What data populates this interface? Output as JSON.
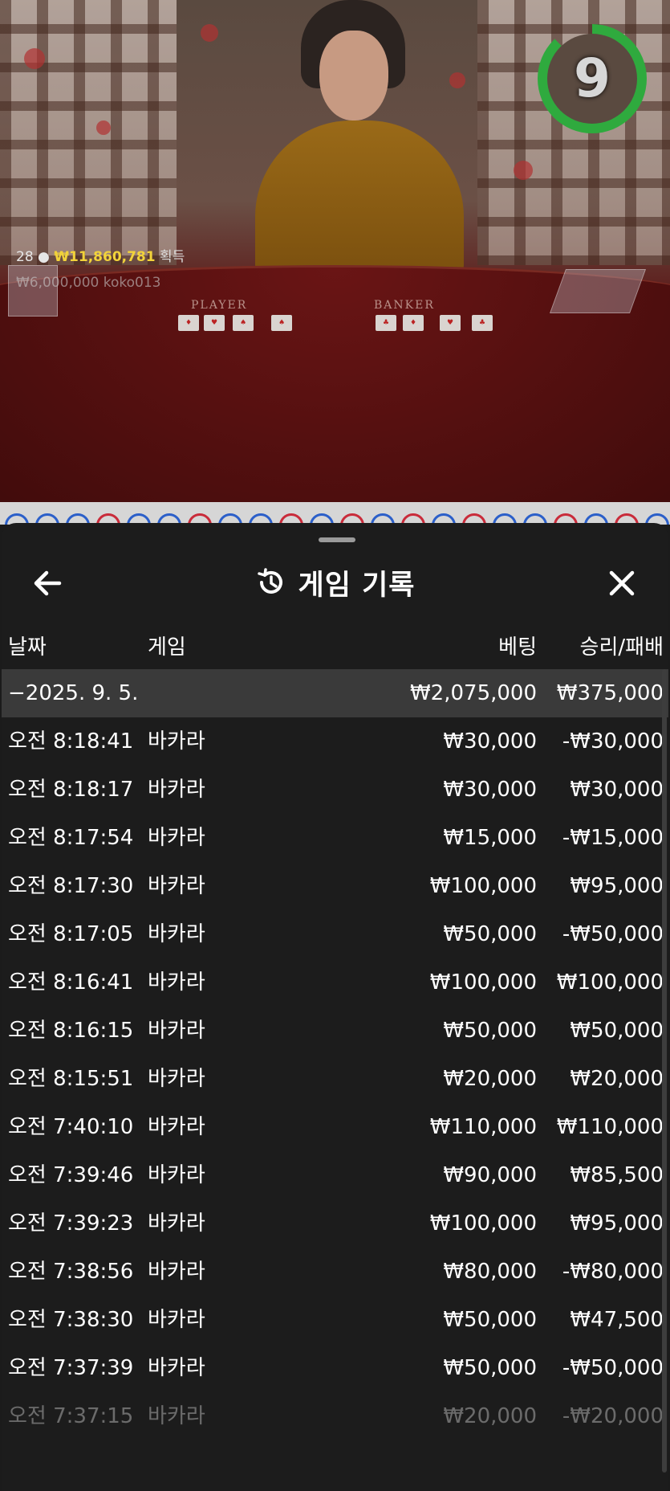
{
  "video": {
    "table_labels": {
      "player": "PLAYER",
      "banker": "BANKER"
    },
    "viewers": "28",
    "win_amount": "₩11,860,781",
    "win_suffix": "획득",
    "last_bet": "₩6,000,000",
    "last_user": "koko013",
    "countdown": "9",
    "countdown_progress": 0.88,
    "colors": {
      "timer": "#2faa3e",
      "win_amount": "#f2d33a"
    }
  },
  "sheet": {
    "title": "게임 기록",
    "back_icon": "arrow-left-icon",
    "title_icon": "history-icon",
    "close_icon": "close-icon",
    "columns": {
      "date": "날짜",
      "game": "게임",
      "bet": "베팅",
      "result": "승리/패배"
    },
    "day": {
      "date": "−2025. 9. 5.",
      "bet": "₩2,075,000",
      "result": "₩375,000"
    },
    "rows": [
      {
        "time": "오전 8:18:41",
        "game": "바카라",
        "bet": "₩30,000",
        "result": "-₩30,000"
      },
      {
        "time": "오전 8:18:17",
        "game": "바카라",
        "bet": "₩30,000",
        "result": "₩30,000"
      },
      {
        "time": "오전 8:17:54",
        "game": "바카라",
        "bet": "₩15,000",
        "result": "-₩15,000"
      },
      {
        "time": "오전 8:17:30",
        "game": "바카라",
        "bet": "₩100,000",
        "result": "₩95,000"
      },
      {
        "time": "오전 8:17:05",
        "game": "바카라",
        "bet": "₩50,000",
        "result": "-₩50,000"
      },
      {
        "time": "오전 8:16:41",
        "game": "바카라",
        "bet": "₩100,000",
        "result": "₩100,000"
      },
      {
        "time": "오전 8:16:15",
        "game": "바카라",
        "bet": "₩50,000",
        "result": "₩50,000"
      },
      {
        "time": "오전 8:15:51",
        "game": "바카라",
        "bet": "₩20,000",
        "result": "₩20,000"
      },
      {
        "time": "오전 7:40:10",
        "game": "바카라",
        "bet": "₩110,000",
        "result": "₩110,000"
      },
      {
        "time": "오전 7:39:46",
        "game": "바카라",
        "bet": "₩90,000",
        "result": "₩85,500"
      },
      {
        "time": "오전 7:39:23",
        "game": "바카라",
        "bet": "₩100,000",
        "result": "₩95,000"
      },
      {
        "time": "오전 7:38:56",
        "game": "바카라",
        "bet": "₩80,000",
        "result": "-₩80,000"
      },
      {
        "time": "오전 7:38:30",
        "game": "바카라",
        "bet": "₩50,000",
        "result": "₩47,500"
      },
      {
        "time": "오전 7:37:39",
        "game": "바카라",
        "bet": "₩50,000",
        "result": "-₩50,000"
      },
      {
        "time": "오전 7:37:15",
        "game": "바카라",
        "bet": "₩20,000",
        "result": "-₩20,000"
      }
    ]
  }
}
